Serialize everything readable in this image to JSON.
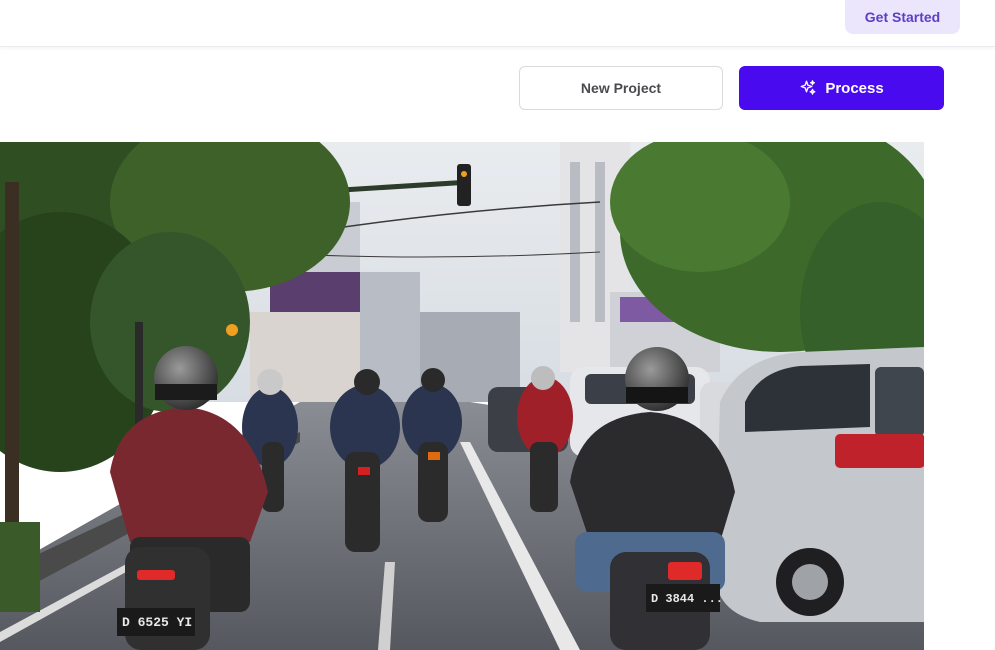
{
  "header": {
    "cta_label": "Get Started"
  },
  "toolbar": {
    "new_project_label": "New Project",
    "process_label": "Process",
    "process_icon": "sparkles-icon"
  },
  "image": {
    "plates": [
      "D 6525 YI",
      "D 3844 ..."
    ]
  },
  "colors": {
    "accent": "#4a0af0",
    "cta_bg": "#ece6fd",
    "cta_text": "#5b3fc4"
  }
}
